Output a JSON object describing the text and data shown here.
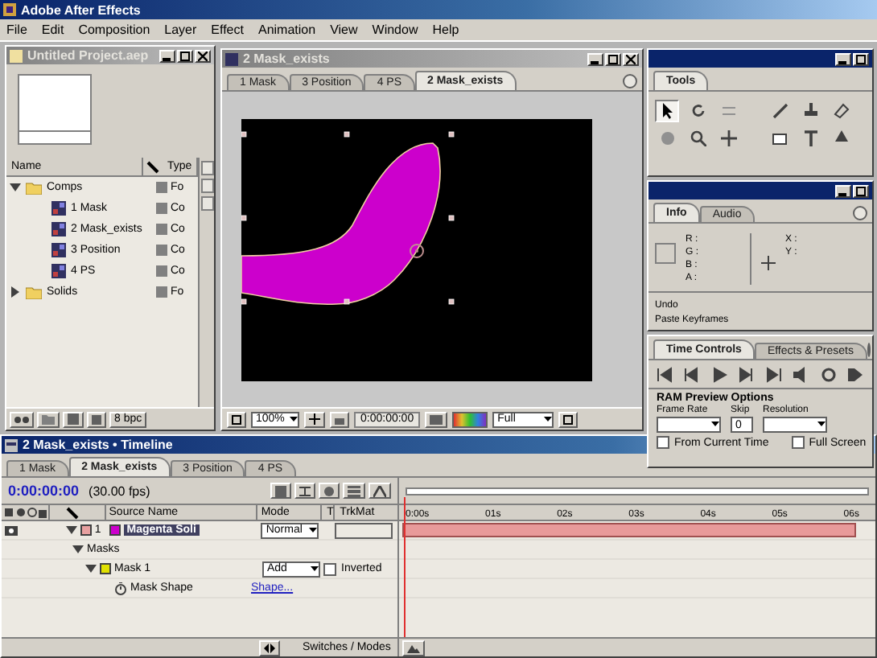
{
  "app_title": "Adobe After Effects",
  "menu": [
    "File",
    "Edit",
    "Composition",
    "Layer",
    "Effect",
    "Animation",
    "View",
    "Window",
    "Help"
  ],
  "project": {
    "title": "Untitled Project.aep",
    "columns": [
      "Name",
      "Type"
    ],
    "items": [
      {
        "name": "Comps",
        "kind": "folder",
        "type": "Fo",
        "expanded": true,
        "children": [
          {
            "name": "1 Mask",
            "kind": "comp",
            "type": "Co"
          },
          {
            "name": "2 Mask_exists",
            "kind": "comp",
            "type": "Co"
          },
          {
            "name": "3 Position",
            "kind": "comp",
            "type": "Co"
          },
          {
            "name": "4 PS",
            "kind": "comp",
            "type": "Co"
          }
        ]
      },
      {
        "name": "Solids",
        "kind": "folder",
        "type": "Fo",
        "expanded": false
      }
    ],
    "bit_depth": "8 bpc"
  },
  "comp": {
    "title": "2 Mask_exists",
    "tabs": [
      {
        "label": "1 Mask",
        "selected": false
      },
      {
        "label": "3 Position",
        "selected": false
      },
      {
        "label": "4 PS",
        "selected": false
      },
      {
        "label": "2 Mask_exists",
        "selected": true
      }
    ],
    "zoom": "100%",
    "time": "0:00:00:00",
    "resolution": "Full"
  },
  "tools": {
    "tabs": [
      {
        "label": "Tools",
        "selected": true
      }
    ]
  },
  "info": {
    "tabs": [
      {
        "label": "Info",
        "selected": true
      },
      {
        "label": "Audio",
        "selected": false
      }
    ],
    "color_labels": [
      "R :",
      "G :",
      "B :",
      "A :"
    ],
    "position_labels": [
      "X :",
      "Y :"
    ],
    "history": [
      "Undo",
      "Paste Keyframes"
    ]
  },
  "time_controls": {
    "tabs": [
      {
        "label": "Time Controls",
        "selected": true
      },
      {
        "label": "Effects & Presets",
        "selected": false
      }
    ],
    "ram_title": "RAM Preview Options",
    "fields": [
      {
        "label": "Frame Rate",
        "kind": "dropdown"
      },
      {
        "label": "Skip",
        "kind": "text",
        "value": "0"
      },
      {
        "label": "Resolution",
        "kind": "dropdown"
      }
    ],
    "options": [
      {
        "label": "From Current Time",
        "checked": false
      },
      {
        "label": "Full Screen",
        "checked": false
      }
    ]
  },
  "timeline": {
    "title": "2 Mask_exists • Timeline",
    "tabs": [
      {
        "label": "1 Mask",
        "selected": false
      },
      {
        "label": "2 Mask_exists",
        "selected": true
      },
      {
        "label": "3 Position",
        "selected": false
      },
      {
        "label": "4 PS",
        "selected": false
      }
    ],
    "time": "0:00:00:00",
    "fps": "(30.00 fps)",
    "columns": [
      "Source Name",
      "Mode",
      "T",
      "TrkMat"
    ],
    "ruler": [
      "0:00s",
      "01s",
      "02s",
      "03s",
      "04s",
      "05s",
      "06s"
    ],
    "layer": {
      "number": "1",
      "name": "Magenta Soli",
      "color": "#cc00cc",
      "mode": "Normal",
      "selected": true,
      "expanded": true
    },
    "masks_label": "Masks",
    "masks_expanded": true,
    "mask": {
      "name": "Mask 1",
      "color": "#e0e000",
      "expanded": true,
      "mode": "Add",
      "invert_label": "Inverted",
      "inverted": false,
      "property": "Mask Shape",
      "value": "Shape..."
    },
    "footer": "Switches / Modes"
  }
}
